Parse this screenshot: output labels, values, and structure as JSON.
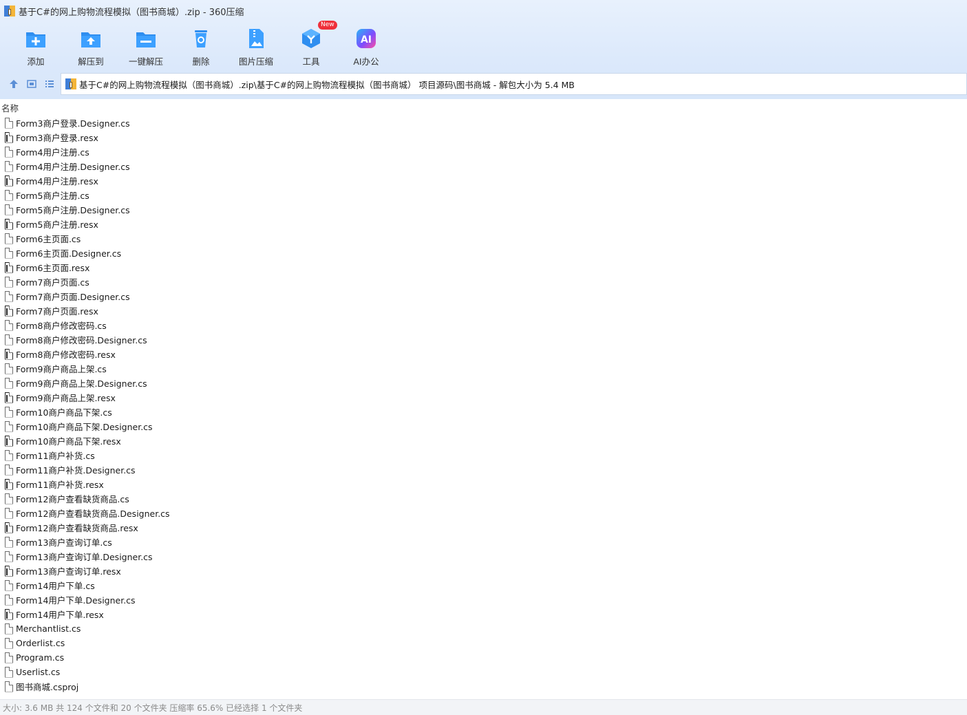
{
  "window": {
    "title": "基于C#的网上购物流程模拟（图书商城）.zip - 360压缩"
  },
  "toolbar": {
    "items": [
      {
        "label": "添加",
        "icon": "add-folder-icon",
        "color": "#2f8ef0"
      },
      {
        "label": "解压到",
        "icon": "extract-to-folder-icon",
        "color": "#2f8ef0"
      },
      {
        "label": "一键解压",
        "icon": "quick-extract-icon",
        "color": "#2f8ef0"
      },
      {
        "label": "删除",
        "icon": "recycle-bin-icon",
        "color": "#2f8ef0"
      },
      {
        "label": "图片压缩",
        "icon": "image-compress-icon",
        "color": "#2f8ef0"
      },
      {
        "label": "工具",
        "icon": "tools-cube-icon",
        "color": "#2f8ef0",
        "badge": "New"
      },
      {
        "label": "AI办公",
        "icon": "ai-office-icon",
        "color": "#8a5cf6"
      }
    ]
  },
  "nav": {
    "buttons": [
      {
        "icon": "up-arrow-icon"
      },
      {
        "icon": "thumbnail-view-icon"
      },
      {
        "icon": "list-view-icon"
      }
    ],
    "address": "基于C#的网上购物流程模拟（图书商城）.zip\\基于C#的网上购物流程模拟（图书商城） 项目源码\\图书商城 - 解包大小为 5.4 MB"
  },
  "columns": {
    "name": "名称"
  },
  "files": [
    {
      "name": "Form3商户登录.Designer.cs",
      "type": "cs"
    },
    {
      "name": "Form3商户登录.resx",
      "type": "resx"
    },
    {
      "name": "Form4用户注册.cs",
      "type": "cs"
    },
    {
      "name": "Form4用户注册.Designer.cs",
      "type": "cs"
    },
    {
      "name": "Form4用户注册.resx",
      "type": "resx"
    },
    {
      "name": "Form5商户注册.cs",
      "type": "cs"
    },
    {
      "name": "Form5商户注册.Designer.cs",
      "type": "cs"
    },
    {
      "name": "Form5商户注册.resx",
      "type": "resx"
    },
    {
      "name": "Form6主页面.cs",
      "type": "cs"
    },
    {
      "name": "Form6主页面.Designer.cs",
      "type": "cs"
    },
    {
      "name": "Form6主页面.resx",
      "type": "resx"
    },
    {
      "name": "Form7商户页面.cs",
      "type": "cs"
    },
    {
      "name": "Form7商户页面.Designer.cs",
      "type": "cs"
    },
    {
      "name": "Form7商户页面.resx",
      "type": "resx"
    },
    {
      "name": "Form8商户修改密码.cs",
      "type": "cs"
    },
    {
      "name": "Form8商户修改密码.Designer.cs",
      "type": "cs"
    },
    {
      "name": "Form8商户修改密码.resx",
      "type": "resx"
    },
    {
      "name": "Form9商户商品上架.cs",
      "type": "cs"
    },
    {
      "name": "Form9商户商品上架.Designer.cs",
      "type": "cs"
    },
    {
      "name": "Form9商户商品上架.resx",
      "type": "resx"
    },
    {
      "name": "Form10商户商品下架.cs",
      "type": "cs"
    },
    {
      "name": "Form10商户商品下架.Designer.cs",
      "type": "cs"
    },
    {
      "name": "Form10商户商品下架.resx",
      "type": "resx"
    },
    {
      "name": "Form11商户补货.cs",
      "type": "cs"
    },
    {
      "name": "Form11商户补货.Designer.cs",
      "type": "cs"
    },
    {
      "name": "Form11商户补货.resx",
      "type": "resx"
    },
    {
      "name": "Form12商户查看缺货商品.cs",
      "type": "cs"
    },
    {
      "name": "Form12商户查看缺货商品.Designer.cs",
      "type": "cs"
    },
    {
      "name": "Form12商户查看缺货商品.resx",
      "type": "resx"
    },
    {
      "name": "Form13商户查询订单.cs",
      "type": "cs"
    },
    {
      "name": "Form13商户查询订单.Designer.cs",
      "type": "cs"
    },
    {
      "name": "Form13商户查询订单.resx",
      "type": "resx"
    },
    {
      "name": "Form14用户下单.cs",
      "type": "cs"
    },
    {
      "name": "Form14用户下单.Designer.cs",
      "type": "cs"
    },
    {
      "name": "Form14用户下单.resx",
      "type": "resx"
    },
    {
      "name": "Merchantlist.cs",
      "type": "cs"
    },
    {
      "name": "Orderlist.cs",
      "type": "cs"
    },
    {
      "name": "Program.cs",
      "type": "cs"
    },
    {
      "name": "Userlist.cs",
      "type": "cs"
    },
    {
      "name": "图书商城.csproj",
      "type": "csproj"
    }
  ],
  "status": "大小: 3.6 MB 共 124 个文件和 20 个文件夹 压缩率 65.6% 已经选择 1 个文件夹"
}
